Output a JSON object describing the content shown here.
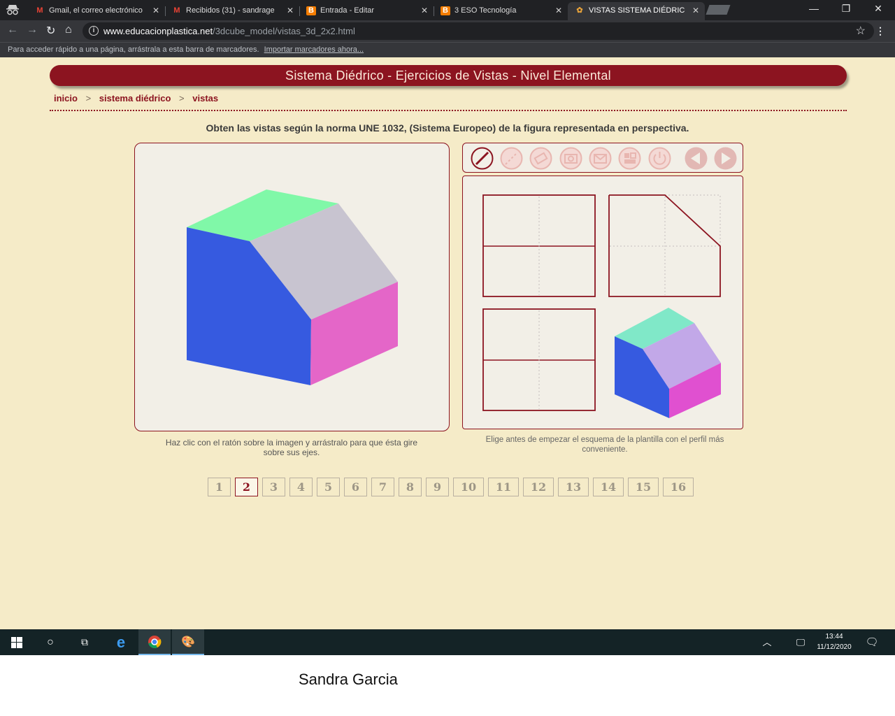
{
  "browser": {
    "tabs": [
      {
        "title": "Gmail, el correo electrónico",
        "icon": "gmail-icon"
      },
      {
        "title": "Recibidos (31) - sandrage",
        "icon": "gmail-icon"
      },
      {
        "title": "Entrada - Editar",
        "icon": "blogger-icon"
      },
      {
        "title": "3 ESO Tecnología",
        "icon": "blogger-icon"
      },
      {
        "title": "VISTAS SISTEMA DIÉDRICO",
        "icon": "site-icon"
      }
    ],
    "url_host": "www.educacionplastica.net",
    "url_path": "/3dcube_model/vistas_3d_2x2.html",
    "bookmarks_text": "Para acceder rápido a una página, arrástrala a esta barra de marcadores.",
    "bookmarks_link": "Importar marcadores ahora..."
  },
  "page": {
    "banner": "Sistema Diédrico - Ejercicios de Vistas - Nivel Elemental",
    "breadcrumb": [
      "inicio",
      "sistema diédrico",
      "vistas"
    ],
    "instruction": "Obten las vistas según la norma UNE 1032, (Sistema Europeo) de la figura representada en perspectiva.",
    "caption_left": "Haz clic con el ratón sobre la imagen y arrástralo para que ésta gire sobre sus ejes.",
    "caption_right": "Elige antes de empezar el esquema de la plantilla con el perfil más conveniente.",
    "tools": [
      "pencil-tool-icon",
      "dashed-line-tool-icon",
      "eraser-icon",
      "camera-icon",
      "mail-icon",
      "layout-icon",
      "power-icon",
      "prev-arrow-icon",
      "next-arrow-icon"
    ],
    "pages": [
      "1",
      "2",
      "3",
      "4",
      "5",
      "6",
      "7",
      "8",
      "9",
      "10",
      "11",
      "12",
      "13",
      "14",
      "15",
      "16"
    ],
    "current_page": "2",
    "colors": {
      "accent": "#8c1420",
      "page_bg": "#f5ebc8",
      "face_top": "#80f8a8",
      "face_slope": "#c8c4d0",
      "face_front": "#365ae0",
      "face_side": "#e466c8"
    }
  },
  "taskbar": {
    "time": "13:44",
    "date": "11/12/2020"
  },
  "signature": "Sandra Garcia"
}
